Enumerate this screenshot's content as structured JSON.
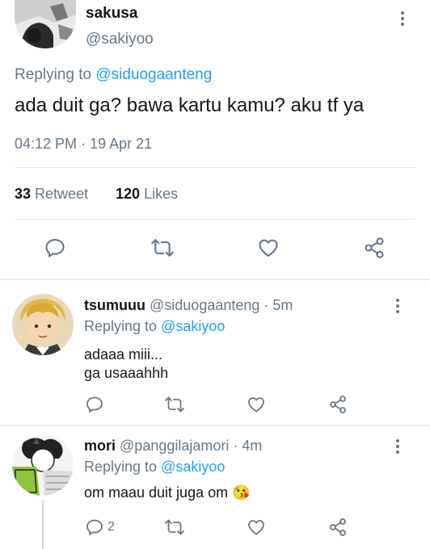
{
  "main_tweet": {
    "author_name": "sakusa",
    "author_handle": "@sakiyoo",
    "replying_prefix": "Replying to",
    "replying_handle": "@siduogaanteng",
    "text": "ada duit ga? bawa kartu kamu? aku tf ya",
    "time": "04:12 PM",
    "separator": "·",
    "date": "19 Apr 21",
    "retweet_count": "33",
    "retweet_label": "Retweet",
    "likes_count": "120",
    "likes_label": "Likes"
  },
  "replies": [
    {
      "author_name": "tsumuuu",
      "author_handle": "@siduogaanteng",
      "age": "· 5m",
      "replying_prefix": "Replying to",
      "replying_handle": "@sakiyoo",
      "text_line1": "adaaa miii...",
      "text_line2": "ga usaaahhh"
    },
    {
      "author_name": "mori",
      "author_handle": "@panggilajamori",
      "age": "· 4m",
      "replying_prefix": "Replying to",
      "replying_handle": "@sakiyoo",
      "text": "om maau duit juga om",
      "emoji": "😘",
      "reply_count": "2"
    }
  ],
  "icons": [
    "reply-icon",
    "retweet-icon",
    "like-icon",
    "share-icon",
    "more-icon"
  ],
  "colors": {
    "accent": "#1da1f2",
    "muted": "#657786",
    "text": "#14171a",
    "divider": "#e1e8ed"
  }
}
